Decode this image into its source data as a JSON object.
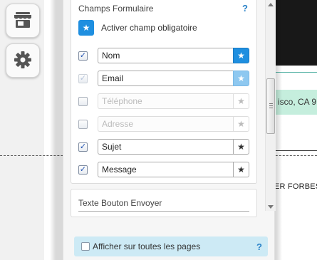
{
  "sidebar": {
    "store_icon": "store-icon",
    "gear_icon": "gear-icon"
  },
  "background": {
    "address_text": "isco, CA 9",
    "name_text": "ER FORBES"
  },
  "panel": {
    "fields_section": {
      "title": "Champs Formulaire",
      "help": "?",
      "mandatory_toggle_label": "Activer champ obligatoire",
      "star": "★",
      "fields": [
        {
          "label": "Nom",
          "checked": true,
          "required": true
        },
        {
          "label": "Email",
          "checked": true,
          "required": true
        },
        {
          "label": "Téléphone",
          "checked": false,
          "required": false
        },
        {
          "label": "Adresse",
          "checked": false,
          "required": false
        },
        {
          "label": "Sujet",
          "checked": true,
          "required": false
        },
        {
          "label": "Message",
          "checked": true,
          "required": false
        }
      ]
    },
    "button_section": {
      "title": "Texte Bouton Envoyer"
    },
    "footer": {
      "label": "Afficher sur toutes les pages",
      "help": "?"
    }
  },
  "colors": {
    "accent": "#1f8fe0",
    "footer_bg": "#cdeaf5",
    "help": "#2a82c8"
  }
}
